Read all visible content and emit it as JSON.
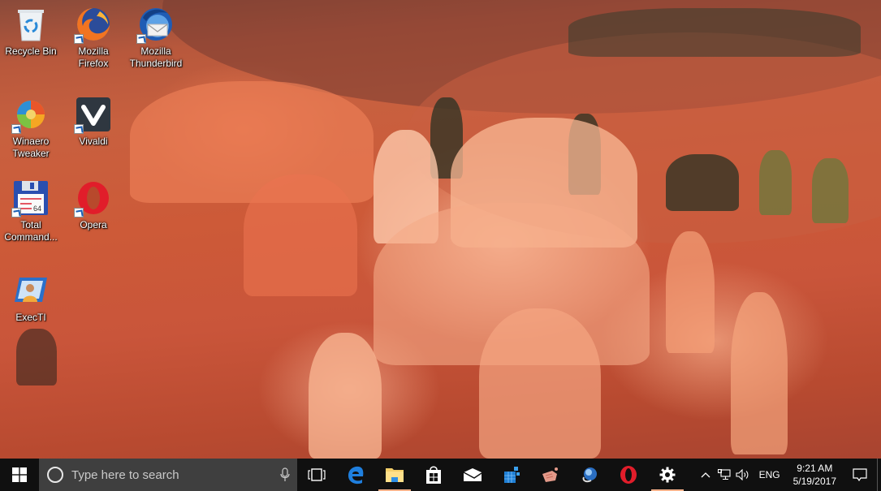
{
  "desktop": {
    "icons": [
      {
        "id": "recycle-bin",
        "label": "Recycle Bin",
        "shortcut": false
      },
      {
        "id": "firefox",
        "label": "Mozilla Firefox",
        "line1": "Mozilla",
        "line2": "Firefox",
        "shortcut": true
      },
      {
        "id": "thunderbird",
        "label": "Mozilla Thunderbird",
        "line1": "Mozilla",
        "line2": "Thunderbird",
        "shortcut": true
      },
      {
        "id": "winaero-tweaker",
        "label": "Winaero Tweaker",
        "line1": "Winaero",
        "line2": "Tweaker",
        "shortcut": true
      },
      {
        "id": "vivaldi",
        "label": "Vivaldi",
        "shortcut": true
      },
      {
        "id": "total-commander",
        "label": "Total Command...",
        "line1": "Total",
        "line2": "Command...",
        "shortcut": true
      },
      {
        "id": "opera",
        "label": "Opera",
        "shortcut": true
      },
      {
        "id": "exectl",
        "label": "ExecTI",
        "shortcut": false
      }
    ]
  },
  "taskbar": {
    "search_placeholder": "Type here to search",
    "pinned": [
      {
        "id": "task-view",
        "icon": "task-view-icon",
        "active": false
      },
      {
        "id": "edge",
        "icon": "edge-icon",
        "active": false
      },
      {
        "id": "file-explorer",
        "icon": "folder-icon",
        "active": true
      },
      {
        "id": "store",
        "icon": "store-icon",
        "active": false
      },
      {
        "id": "mail",
        "icon": "mail-icon",
        "active": false
      },
      {
        "id": "registry-editor",
        "icon": "registry-icon",
        "active": false
      },
      {
        "id": "app-hand",
        "icon": "hand-app-icon",
        "active": false
      },
      {
        "id": "app-magnifier",
        "icon": "magnifier-app-icon",
        "active": false
      },
      {
        "id": "opera",
        "icon": "opera-icon",
        "active": false
      },
      {
        "id": "settings",
        "icon": "gear-icon",
        "active": true
      }
    ],
    "tray": {
      "language": "ENG",
      "time": "9:21 AM",
      "date": "5/19/2017"
    },
    "colors": {
      "background": "#101010",
      "search_background": "#3f3f3f",
      "active_indicator": "#f7b18a"
    }
  }
}
